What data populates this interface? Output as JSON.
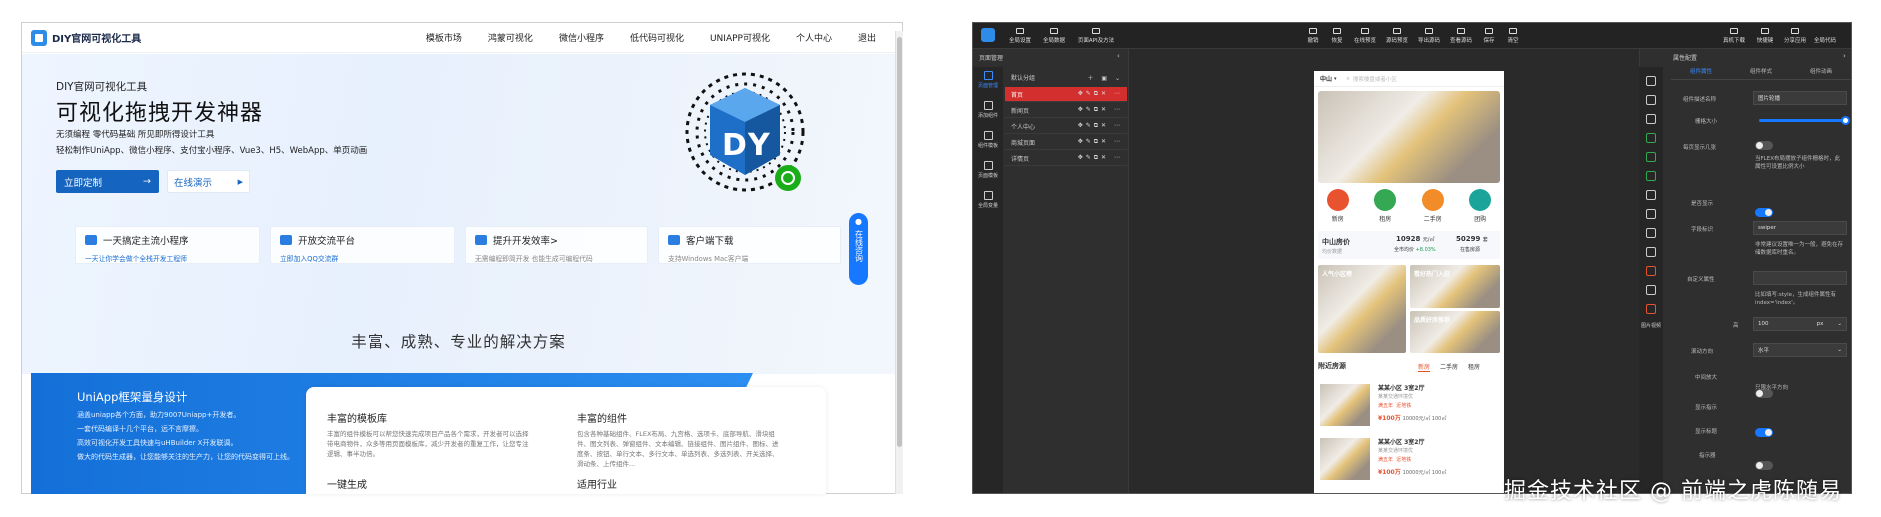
{
  "site": {
    "logo": "DIY官网可视化工具",
    "nav": [
      "模板市场",
      "鸿蒙可视化",
      "微信小程序",
      "低代码可视化",
      "UNIAPP可视化",
      "个人中心",
      "退出"
    ],
    "hero": {
      "small": "DIY官网可视化工具",
      "title": "可视化拖拽开发神器",
      "sub1": "无须编程 零代码基础 所见即所得设计工具",
      "sub2": "轻松制作UniApp、微信小程序、支付宝小程序、Vue3、H5、WebApp、单页动画",
      "btn_primary": "立即定制",
      "btn_ghost": "在线演示"
    },
    "cards": [
      {
        "title": "一天搞定主流小程序",
        "desc": "一天让你学会做个全栈开发工程师"
      },
      {
        "title": "开放交流平台",
        "desc": "立即加入QQ交流群"
      },
      {
        "title": "提升开发效率>",
        "desc": "无需编程即简开发 也能生成可编程代码"
      },
      {
        "title": "客户端下载",
        "desc": "支持Windows Mac客户端"
      }
    ],
    "help": "在线咨询",
    "section_title": "丰富、成熟、专业的解决方案",
    "blue": {
      "title": "UniApp框架量身设计",
      "lines": [
        "涵盖uniapp各个方面，助力9007Uniapp+开发者。",
        "一套代码编译十几个平台，远不言摩擦。",
        "高效可视化开发工具快速与uHBuilder X开发联调。",
        "做大的代码生成器，让您能够关注的生产力，让您的代码变得可上线。"
      ]
    },
    "solutions": [
      {
        "title": "丰富的模板库",
        "desc": "丰富的组件模板可以帮您快速完成项目产品各个需求，开发者可以选择带电商物件，众多等用页面模板库，减少开发者的重复工作，让您专注逻辑、事半功倍。"
      },
      {
        "title": "丰富的组件",
        "desc": "包含各种基础组件、FLEX布局、九宫格、选项卡、底部导航、滑块组件、图文列表、弹窗组件、文本编辑、链接组件、图片组件、图标、进度条、按钮、单行文本、多行文本、单选列表、多选列表、开关选择、滑动条、上传组件..."
      },
      {
        "title": "一键生成",
        "desc": ""
      },
      {
        "title": "适用行业",
        "desc": ""
      }
    ]
  },
  "editor": {
    "toolbar_left": [
      "全局设置",
      "全局数据",
      "页面API及方法"
    ],
    "toolbar_center": [
      "撤销",
      "恢复",
      "在线预览",
      "源码预览",
      "导出源码",
      "查看源码",
      "保存",
      "清空"
    ],
    "toolbar_right": [
      "真机下载",
      "快捷键",
      "分享应用",
      "全局代码"
    ],
    "left_title": "页面管理",
    "left_side": [
      "页面管理",
      "添加组件",
      "组件模板",
      "页面模板",
      "全局变量"
    ],
    "page_group": "默认分组",
    "pages": [
      "首页",
      "新闻页",
      "个人中心",
      "商城页面",
      "详情页"
    ],
    "phone": {
      "city": "中山",
      "search_placeholder": "搜索楼盘或者小区",
      "icons": [
        "新房",
        "租房",
        "二手房",
        "团购"
      ],
      "stat_title": "中山房价",
      "stat_sub": "均价数据",
      "stat1_value": "10928",
      "stat1_unit": "元/㎡",
      "stat1_label": "全市均价",
      "stat1_change": "+8.03%",
      "stat2_value": "50299",
      "stat2_unit": "套",
      "stat2_label": "在售房源",
      "tile1": "人气小区榜",
      "tile2": "看好热门入驻",
      "tile3": "品质好房推荐",
      "list_title": "附近房源",
      "tabs": [
        "新房",
        "二手房",
        "租房"
      ],
      "listings": [
        {
          "title": "某某小区 3室2厅",
          "sub": "某某交通环境优",
          "tags": [
            "满五年",
            "近地铁"
          ],
          "price": "¥100万",
          "detail": "10000元/㎡ 100㎡"
        },
        {
          "title": "某某小区 3室2厅",
          "sub": "某某交通环境优",
          "tags": [
            "满五年",
            "近地铁"
          ],
          "price": "¥100万",
          "detail": "10000元/㎡ 100㎡"
        }
      ]
    },
    "right_title": "属性配置",
    "right_tabs": [
      "组件属性",
      "组件样式",
      "组件动画"
    ],
    "props": [
      {
        "label": "组件描述名称",
        "value": "图片轮播"
      },
      {
        "label": "栅格大小",
        "value": ""
      },
      {
        "label": "每页显示几张",
        "value": "当FLEX布局摆放子组件栅格时，此属性可设置比例大小"
      },
      {
        "label": "是否显示",
        "value": ""
      },
      {
        "label": "字段标识",
        "value": "swiper"
      },
      {
        "label": "",
        "value": "非常建议设置唯一为一般，避免在存储数据库时重名。"
      },
      {
        "label": "自定义属性",
        "value": ""
      },
      {
        "label": "",
        "value": "比如填写:style，生成组件属性有index='index'。"
      },
      {
        "label": "高",
        "value": "100"
      },
      {
        "label": "滚动方向",
        "value": "水平"
      },
      {
        "label": "中间放大",
        "value": ""
      },
      {
        "label": "",
        "value": "只限水平方向"
      },
      {
        "label": "显示指示",
        "value": ""
      },
      {
        "label": "显示标题",
        "value": ""
      },
      {
        "label": "指示器",
        "value": ""
      }
    ],
    "height_unit": "px",
    "right_side_label": "图片视频"
  },
  "watermark": "掘金技术社区 @ 前端之虎陈随易"
}
